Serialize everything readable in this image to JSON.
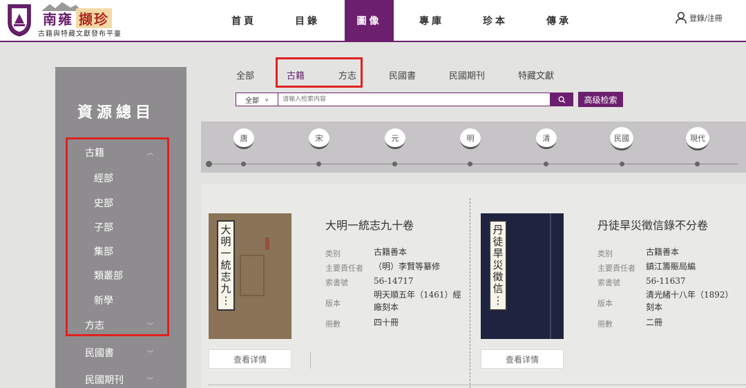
{
  "header": {
    "logo_name": "南雍",
    "logo_seal": "撷珍",
    "logo_subtitle": "古籍與特藏文獻發布平臺",
    "nav": [
      "首頁",
      "目錄",
      "圖像",
      "專庫",
      "珍本",
      "傳承"
    ],
    "active_nav": "圖像",
    "login_label": "登錄/注冊"
  },
  "sidebar": {
    "title": "資源總目",
    "items": [
      {
        "label": "古籍",
        "expanded": true,
        "children": [
          "經部",
          "史部",
          "子部",
          "集部",
          "類叢部",
          "新學"
        ]
      },
      {
        "label": "方志",
        "expanded": false
      },
      {
        "label": "民國書",
        "expanded": false
      },
      {
        "label": "民國期刊",
        "expanded": false
      }
    ]
  },
  "tabs": [
    "全部",
    "古籍",
    "方志",
    "民國書",
    "民國期刊",
    "特藏文獻"
  ],
  "search": {
    "select_value": "全部",
    "placeholder": "请输入检索内容",
    "advanced_label": "高级检索"
  },
  "timeline": [
    "唐",
    "宋",
    "元",
    "明",
    "清",
    "民國",
    "現代"
  ],
  "books": [
    {
      "title": "大明一統志九十卷",
      "cover_text": [
        "大",
        "明",
        "一",
        "統",
        "志",
        "九",
        "⋮"
      ],
      "cover_color": "#8a7356",
      "fields": [
        {
          "key": "类别",
          "value": "古籍善本"
        },
        {
          "key": "主要責任者",
          "value": "（明）李賢等纂修"
        },
        {
          "key": "索書號",
          "value": "56-14717"
        },
        {
          "key": "版本",
          "value": "明天順五年（1461）經廠刻本"
        },
        {
          "key": "冊數",
          "value": "四十冊"
        }
      ],
      "button": "查看详情"
    },
    {
      "title": "丹徒旱災徵信錄不分卷",
      "cover_text": [
        "丹",
        "徒",
        "旱",
        "災",
        "徵",
        "信",
        "⋮"
      ],
      "cover_color": "#1e2440",
      "fields": [
        {
          "key": "类别",
          "value": "古籍善本"
        },
        {
          "key": "主要責任者",
          "value": "鎮江籌賑局編"
        },
        {
          "key": "索書號",
          "value": "56-11637"
        },
        {
          "key": "版本",
          "value": "清光緒十八年（1892）刻本"
        },
        {
          "key": "冊數",
          "value": "二冊"
        }
      ],
      "button": "查看详情"
    }
  ],
  "colors": {
    "brand": "#6b1f6e",
    "highlight": "#e02020",
    "sidebar_bg": "#8e8c8e"
  }
}
